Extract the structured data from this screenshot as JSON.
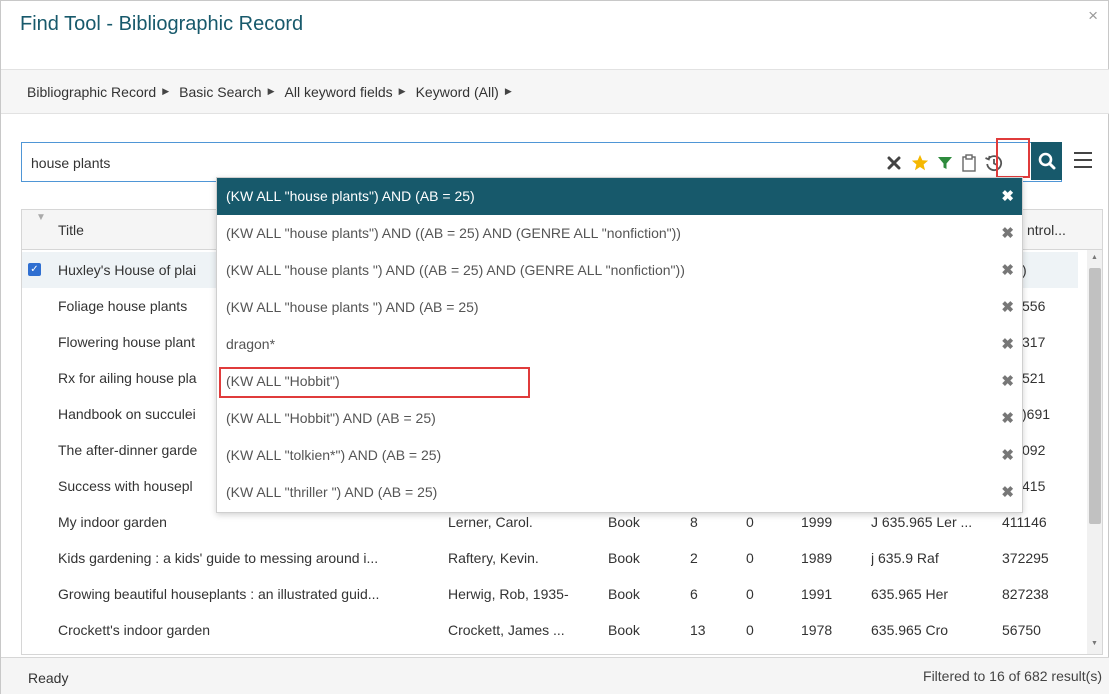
{
  "window": {
    "title": "Find Tool - Bibliographic Record",
    "close_label": "×"
  },
  "breadcrumb": [
    {
      "label": "Bibliographic Record"
    },
    {
      "label": "Basic Search"
    },
    {
      "label": "All keyword fields"
    },
    {
      "label": "Keyword (All)"
    }
  ],
  "search": {
    "value": "house plants",
    "icons": [
      "clear-icon",
      "favorite-star-icon",
      "filter-icon",
      "clipboard-icon",
      "search-history-icon",
      "search-icon",
      "menu-icon"
    ]
  },
  "grid": {
    "headers": {
      "title": "Title",
      "control": "ntrol..."
    },
    "rows": [
      {
        "title": "Huxley's House of plai",
        "author": "",
        "format": "",
        "a": "",
        "b": "",
        "year": "",
        "call": "",
        "control": ")",
        "selected": true
      },
      {
        "title": "Foliage house plants",
        "author": "",
        "format": "",
        "a": "",
        "b": "",
        "year": "",
        "call": "",
        "control": "556"
      },
      {
        "title": "Flowering house plant",
        "author": "",
        "format": "",
        "a": "",
        "b": "",
        "year": "",
        "call": "",
        "control": "317"
      },
      {
        "title": "Rx for ailing house pla",
        "author": "",
        "format": "",
        "a": "",
        "b": "",
        "year": "",
        "call": "",
        "control": "521"
      },
      {
        "title": "Handbook on succulei",
        "author": "",
        "format": "",
        "a": "",
        "b": "",
        "year": "",
        "call": "",
        "control": ")691"
      },
      {
        "title": "The after-dinner garde",
        "author": "",
        "format": "",
        "a": "",
        "b": "",
        "year": "",
        "call": "",
        "control": "092"
      },
      {
        "title": "Success with housepl",
        "author": "",
        "format": "",
        "a": "",
        "b": "",
        "year": "",
        "call": "",
        "control": "415"
      },
      {
        "title": "My indoor garden",
        "author": "Lerner, Carol.",
        "format": "Book",
        "a": "8",
        "b": "0",
        "year": "1999",
        "call": "J 635.965 Ler ...",
        "control": "411146"
      },
      {
        "title": "Kids gardening : a kids' guide to messing around i...",
        "author": "Raftery, Kevin.",
        "format": "Book",
        "a": "2",
        "b": "0",
        "year": "1989",
        "call": "j 635.9 Raf",
        "control": "372295"
      },
      {
        "title": "Growing beautiful houseplants : an illustrated guid...",
        "author": "Herwig, Rob, 1935-",
        "format": "Book",
        "a": "6",
        "b": "0",
        "year": "1991",
        "call": "635.965 Her",
        "control": "827238"
      },
      {
        "title": "Crockett's indoor garden",
        "author": "Crockett, James ...",
        "format": "Book",
        "a": "13",
        "b": "0",
        "year": "1978",
        "call": "635.965 Cro",
        "control": "56750"
      }
    ]
  },
  "dropdown": {
    "items": [
      {
        "label": "(KW ALL \"house plants\") AND (AB = 25)",
        "active": true
      },
      {
        "label": "(KW ALL \"house plants\") AND ((AB = 25) AND (GENRE ALL \"nonfiction\"))"
      },
      {
        "label": "(KW ALL \"house plants \") AND ((AB = 25) AND (GENRE ALL \"nonfiction\"))"
      },
      {
        "label": "(KW ALL \"house plants \") AND (AB = 25)"
      },
      {
        "label": "dragon*"
      },
      {
        "label": "(KW ALL \"Hobbit\")",
        "highlighted": true
      },
      {
        "label": "(KW ALL \"Hobbit\") AND (AB = 25)"
      },
      {
        "label": "(KW ALL \"tolkien*\") AND (AB = 25)"
      },
      {
        "label": "(KW ALL \"thriller \") AND (AB = 25)"
      }
    ],
    "remove_label": "✖"
  },
  "status": {
    "left": "Ready",
    "right": "Filtered to 16 of 682 result(s)"
  },
  "colors": {
    "accent": "#17596b",
    "highlight": "#e03b3b",
    "star": "#f5b800",
    "filter": "#2e8b3d"
  }
}
